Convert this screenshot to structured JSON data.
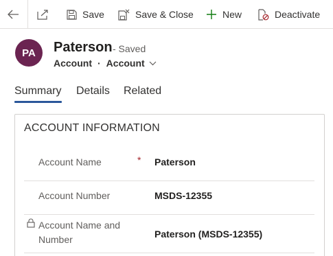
{
  "commands": {
    "save_label": "Save",
    "save_close_label": "Save & Close",
    "new_label": "New",
    "deactivate_label": "Deactivate"
  },
  "record": {
    "initials": "PA",
    "name": "Paterson",
    "status": "- Saved",
    "entity": "Account",
    "separator": "·",
    "form": "Account"
  },
  "tabs": [
    {
      "label": "Summary",
      "active": true
    },
    {
      "label": "Details",
      "active": false
    },
    {
      "label": "Related",
      "active": false
    }
  ],
  "section": {
    "title": "ACCOUNT INFORMATION",
    "fields": [
      {
        "label": "Account Name",
        "required_marker": "*",
        "value": "Paterson"
      },
      {
        "label": "Account Number",
        "value": "MSDS-12355"
      },
      {
        "label_line1": "Account Name and",
        "label_line2": "Number",
        "value": "Paterson (MSDS-12355)",
        "locked": true
      }
    ]
  },
  "colors": {
    "avatar_bg": "#6b2451",
    "tab_underline": "#2b579a",
    "required": "#a4262c"
  }
}
